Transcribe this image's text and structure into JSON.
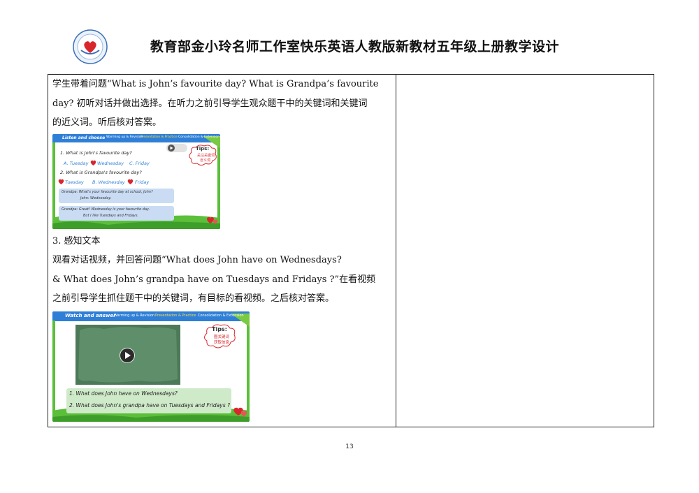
{
  "header": {
    "title": "教育部金小玲名师工作室快乐英语人教版新教材五年级上册教学设计"
  },
  "content": {
    "p1_line1": "学生带着问题“What is John’s favourite day? What is Grandpa’s favourite",
    "p1_line2": "day? 初听对话并做出选择。在听力之前引导学生观众题干中的关键词和关键词",
    "p1_line3": "的近义词。听后核对答案。",
    "section3": "3. 感知文本",
    "p2_line1": "观看对话视频，并回答问题“What does John have on Wednesdays?",
    "p2_line2": "& What does John’s grandpa have on Tuesdays and  Fridays ?”在看视频",
    "p2_line3": "之前引导学生抓住题干中的关键词，有目标的看视频。之后核对答案。"
  },
  "slide1": {
    "tab_active": "Listen and choose",
    "tabs": [
      "Warming up & Revision",
      "Presentation & Practice",
      "Consolidation & Extension"
    ],
    "tips_title": "Tips:",
    "tips_line1": "关注关键词",
    "tips_line2": "近义词",
    "q1": "1. What is John's favourite day?",
    "q1_a": "A. Tuesday",
    "q1_b": "Wednesday",
    "q1_c": "C. Friday",
    "q2": "2. What is Grandpa's favourite day?",
    "q2_a": "Tuesday",
    "q2_b": "B. Wednesday",
    "q2_c": "Friday",
    "box1_line1": "Grandpa: What's your favourite day at school, John?",
    "box1_line2": "John: Wednesday.",
    "box2_line1": "Grandpa: Great! Wednesday is your favourite day.",
    "box2_line2": "But I like Tuesdays and Fridays."
  },
  "slide2": {
    "tab_active": "Watch and answer",
    "tabs": [
      "Warming up & Revision",
      "Presentation & Practice",
      "Consolidation & Extension"
    ],
    "tips_title": "Tips:",
    "tips_line1": "圈关键词",
    "tips_line2": "获取信息",
    "q1": "1. What does John have on Wednesdays?",
    "q2": "2. What does John's grandpa have on Tuesdays and  Fridays ?"
  },
  "footer": {
    "page_number": "13"
  },
  "colors": {
    "slide_blue": "#2f7fd6",
    "slide_green": "#5bbf3a",
    "tips_red": "#d9262c",
    "box_blue": "#c9dcf4",
    "box_green": "#cfeac9"
  }
}
